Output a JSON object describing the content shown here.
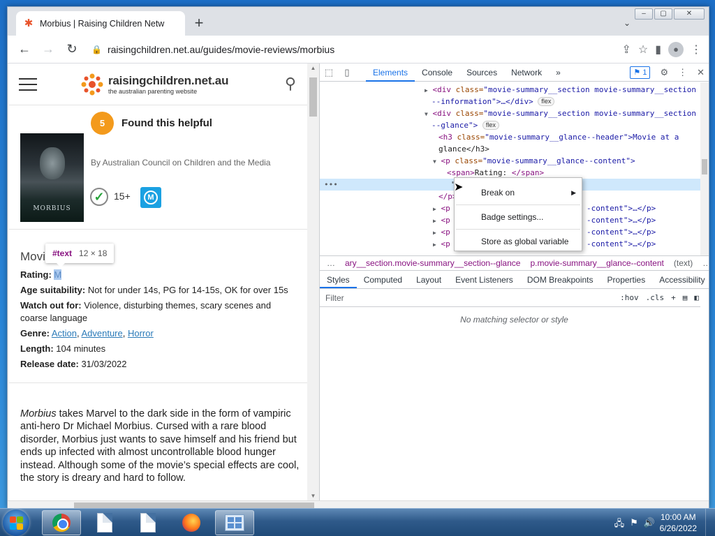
{
  "browser": {
    "tab_title": "Morbius | Raising Children Netw",
    "tab_close": "✕",
    "new_tab": "+",
    "url": "raisingchildren.net.au/guides/movie-reviews/morbius",
    "window_controls": [
      "‒",
      "▢",
      "✕"
    ]
  },
  "site": {
    "logo_name": "raisingchildren.net.au",
    "logo_tagline": "the australian parenting website",
    "helpful_count": "5",
    "helpful_label": "Found this helpful",
    "byline": "By Australian Council on Children and the Media",
    "age_label": "15+",
    "m_badge": "M",
    "poster_title": "MORBIUS",
    "glance_header": "Movie at a glance",
    "rating_label": "Rating:",
    "rating_value": "M",
    "age_suit_label": "Age suitability:",
    "age_suit_value": "Not for under 14s, PG for 14-15s, OK for over 15s",
    "watch_label": "Watch out for:",
    "watch_value": "Violence, disturbing themes, scary scenes and coarse language",
    "genre_label": "Genre:",
    "genres": [
      "Action",
      "Adventure",
      "Horror"
    ],
    "length_label": "Length:",
    "length_value": "104 minutes",
    "release_label": "Release date:",
    "release_value": "31/03/2022",
    "review_title": "Morbius",
    "review_text": " takes Marvel to the dark side in the form of vampiric anti-hero Dr Michael Morbius. Cursed with a rare blood disorder, Morbius just wants to save himself and his friend but ends up infected with almost uncontrollable blood hunger instead. Although some of the movie’s special effects are cool, the story is dreary and hard to follow."
  },
  "inspect_tooltip": {
    "node": "#text",
    "size": "12 × 18"
  },
  "devtools": {
    "tabs": [
      "Elements",
      "Console",
      "Sources",
      "Network"
    ],
    "more": "»",
    "issues_count": "1",
    "flex_badge": "flex",
    "tree": {
      "l1_cls": "\"movie-summary__section movie-summary__section",
      "l1b": "--information\">…</div>",
      "l2_cls": "\"movie-summary__section movie-summary__section",
      "l2b": "--glance\">",
      "l3": "\"movie-summary__glance--header\">Movie at a",
      "l3b": "glance</h3>",
      "l4": "\"movie-summary__glance--content\">",
      "l5": "Rating: ",
      "l6": "\"M",
      "l7": "</p>",
      "content_cls": "-content\">…</p>",
      "trail": "\"movie-summary__glance--content\"></p>"
    },
    "context_menu": [
      "Break on",
      "Badge settings...",
      "Store as global variable"
    ],
    "breadcrumb_a": "ary__section.movie-summary__section--glance",
    "breadcrumb_b": "p.movie-summary__glance--content",
    "breadcrumb_c": "(text)",
    "breadcrumb_more": "…",
    "style_tabs": [
      "Styles",
      "Computed",
      "Layout",
      "Event Listeners",
      "DOM Breakpoints",
      "Properties",
      "Accessibility"
    ],
    "filter_placeholder": "Filter",
    "hov": ":hov",
    "cls": ".cls",
    "no_match": "No matching selector or style"
  },
  "taskbar": {
    "time": "10:00 AM",
    "date": "6/26/2022"
  },
  "colors": {
    "accent": "#1a73e8",
    "helpful_badge": "#f39a1c",
    "m_badge": "#1ba1e2",
    "tag": "#881280",
    "attr": "#994500",
    "value": "#1a1aa6"
  }
}
